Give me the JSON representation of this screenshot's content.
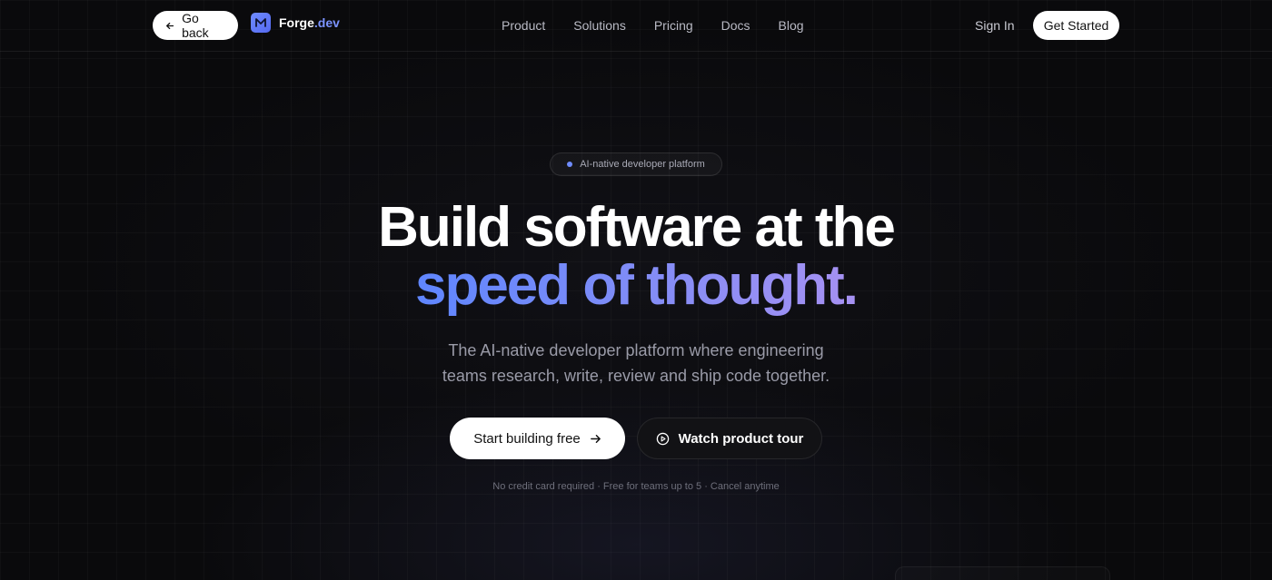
{
  "header": {
    "back_label": "Go back",
    "logo": {
      "name": "Forge",
      "accent": ".dev",
      "icon": "m-logo-icon",
      "color": "#6f8cff"
    },
    "nav": [
      "Product",
      "Solutions",
      "Pricing",
      "Docs",
      "Blog"
    ],
    "sign_in": "Sign In",
    "get_started": "Get Started"
  },
  "hero": {
    "badge": "AI-native developer platform",
    "title_line1": "Build software at the",
    "title_line2": "speed of thought.",
    "subtitle_line1": "The AI-native developer platform where engineering",
    "subtitle_line2": "teams research, write, review and ship code together.",
    "primary_cta": "Start building free",
    "secondary_cta": "Watch product tour",
    "fineprint": "No credit card required · Free for teams up to 5 · Cancel anytime"
  },
  "colors": {
    "background": "#0a0a0c",
    "accent_start": "#5f86ff",
    "accent_end": "#a691f2",
    "button_light": "#ffffff"
  },
  "icons": {
    "back": "arrow-left-icon",
    "primary_cta": "arrow-right-icon",
    "secondary_cta": "play-circle-icon",
    "badge": "dot-icon"
  }
}
